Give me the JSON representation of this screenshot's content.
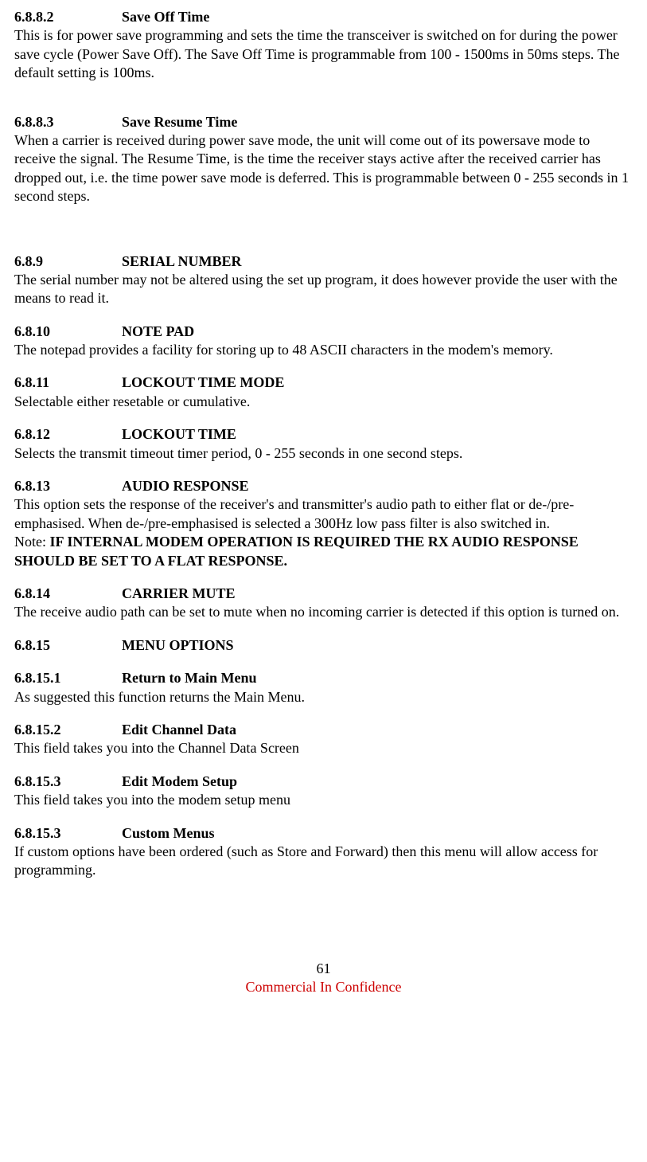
{
  "sections": {
    "s6_8_8_2": {
      "num": "6.8.8.2",
      "title": "Save Off Time",
      "body": "This is for power save programming and sets the time the transceiver is switched on for during the power save cycle (Power Save Off). The Save Off Time is programmable from 100 - 1500ms in 50ms steps. The default setting is 100ms."
    },
    "s6_8_8_3": {
      "num": "6.8.8.3",
      "title": "Save Resume Time",
      "body": "When a carrier is received during power save mode, the unit will come out of its powersave mode to receive the signal. The Resume Time, is the time the receiver stays active after the received carrier has dropped out, i.e. the time power save mode is deferred. This is programmable between 0 - 255 seconds in 1 second steps."
    },
    "s6_8_9": {
      "num": "6.8.9",
      "title": "SERIAL NUMBER",
      "body": "The serial number may not be altered using the set up program, it does however provide the user with the means to read it."
    },
    "s6_8_10": {
      "num": "6.8.10",
      "title": "NOTE PAD",
      "body": "The notepad provides a facility for storing up to 48 ASCII characters in the modem's memory."
    },
    "s6_8_11": {
      "num": "6.8.11",
      "title": "LOCKOUT TIME MODE",
      "body": "Selectable either resetable or cumulative."
    },
    "s6_8_12": {
      "num": "6.8.12",
      "title": "LOCKOUT TIME",
      "body": "Selects the transmit timeout timer period, 0 - 255 seconds in one second steps."
    },
    "s6_8_13": {
      "num": "6.8.13",
      "title": "AUDIO RESPONSE",
      "body": "This option sets the response of the receiver's and transmitter's audio path to either flat or de-/pre-emphasised. When de-/pre-emphasised is selected a 300Hz low pass filter is also switched in.",
      "note_prefix": "Note: ",
      "note_bold": "IF INTERNAL MODEM OPERATION IS REQUIRED THE RX AUDIO RESPONSE SHOULD BE SET TO A FLAT RESPONSE."
    },
    "s6_8_14": {
      "num": "6.8.14",
      "title": "CARRIER MUTE",
      "body": "The receive audio path can be set to mute when no incoming carrier is detected if this option is turned on."
    },
    "s6_8_15": {
      "num": "6.8.15",
      "title": "MENU OPTIONS"
    },
    "s6_8_15_1": {
      "num": "6.8.15.1",
      "title": "Return to Main Menu",
      "body": "As suggested this function returns the Main Menu."
    },
    "s6_8_15_2": {
      "num": "6.8.15.2",
      "title": "Edit Channel Data",
      "body": "This field takes you into the Channel Data Screen"
    },
    "s6_8_15_3a": {
      "num": "6.8.15.3",
      "title": "Edit Modem Setup",
      "body": "This field takes you into the modem setup menu"
    },
    "s6_8_15_3b": {
      "num": "6.8.15.3",
      "title": "Custom Menus",
      "body": "If custom options have been ordered (such as Store and Forward) then this menu will allow access for programming."
    }
  },
  "footer": {
    "page_number": "61",
    "confidential": "Commercial In Confidence"
  }
}
